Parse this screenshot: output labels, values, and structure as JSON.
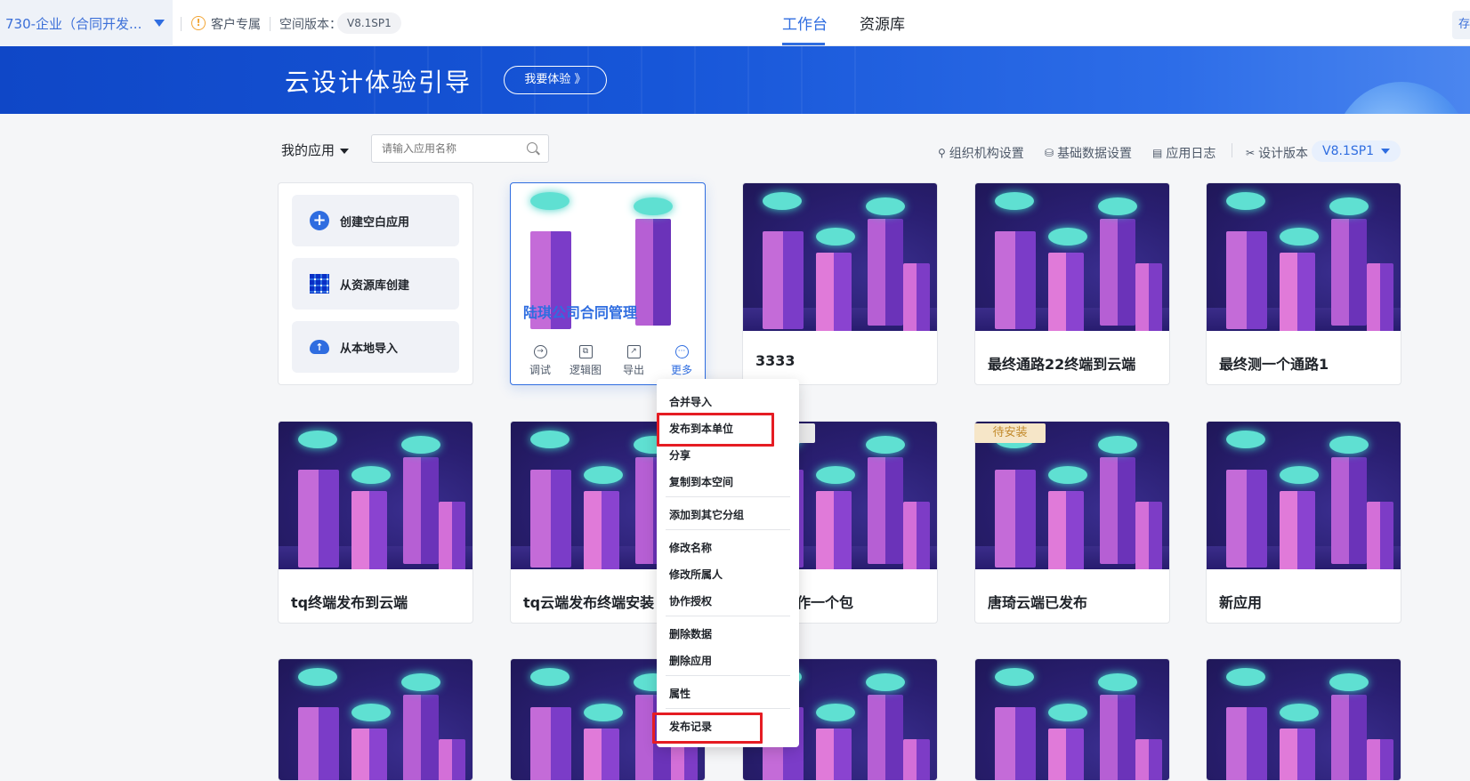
{
  "topbar": {
    "workspace": "730-企业（合同开发...",
    "customer_label": "客户专属",
    "space_version_label": "空间版本：",
    "space_version": "V8.1SP1",
    "tabs": [
      {
        "label": "工作台",
        "active": true
      },
      {
        "label": "资源库",
        "active": false
      }
    ],
    "right_button": "存"
  },
  "banner": {
    "title": "云设计体验引导",
    "try_button": "我要体验 》"
  },
  "toolbar": {
    "my_apps": "我的应用",
    "search_placeholder": "请输入应用名称",
    "links": [
      "组织机构设置",
      "基础数据设置",
      "应用日志"
    ],
    "design_version_label": "设计版本",
    "design_version": "V8.1SP1"
  },
  "create_panel": {
    "items": [
      "创建空白应用",
      "从资源库创建",
      "从本地导入"
    ]
  },
  "focus_card": {
    "title": "陆琪公司合同管理",
    "actions": [
      "调试",
      "逻辑图",
      "导出",
      "更多"
    ]
  },
  "cards": {
    "row1": [
      "3333",
      "最终通路22终端到云端",
      "最终测一个通路1"
    ],
    "row2": [
      "tq终端发布到云端",
      "tq云端发布终端安装",
      "作一个包",
      "唐琦云端已发布",
      "新应用"
    ]
  },
  "badge": "待安装",
  "menu": {
    "items": [
      "合并导入",
      "发布到本单位",
      "分享",
      "复制到本空间",
      "添加到其它分组",
      "修改名称",
      "修改所属人",
      "协作授权",
      "删除数据",
      "删除应用",
      "属性",
      "发布记录"
    ]
  },
  "colors": {
    "accent": "#2f6de0",
    "highlight": "#e51c23",
    "banner": "#1756d8"
  }
}
